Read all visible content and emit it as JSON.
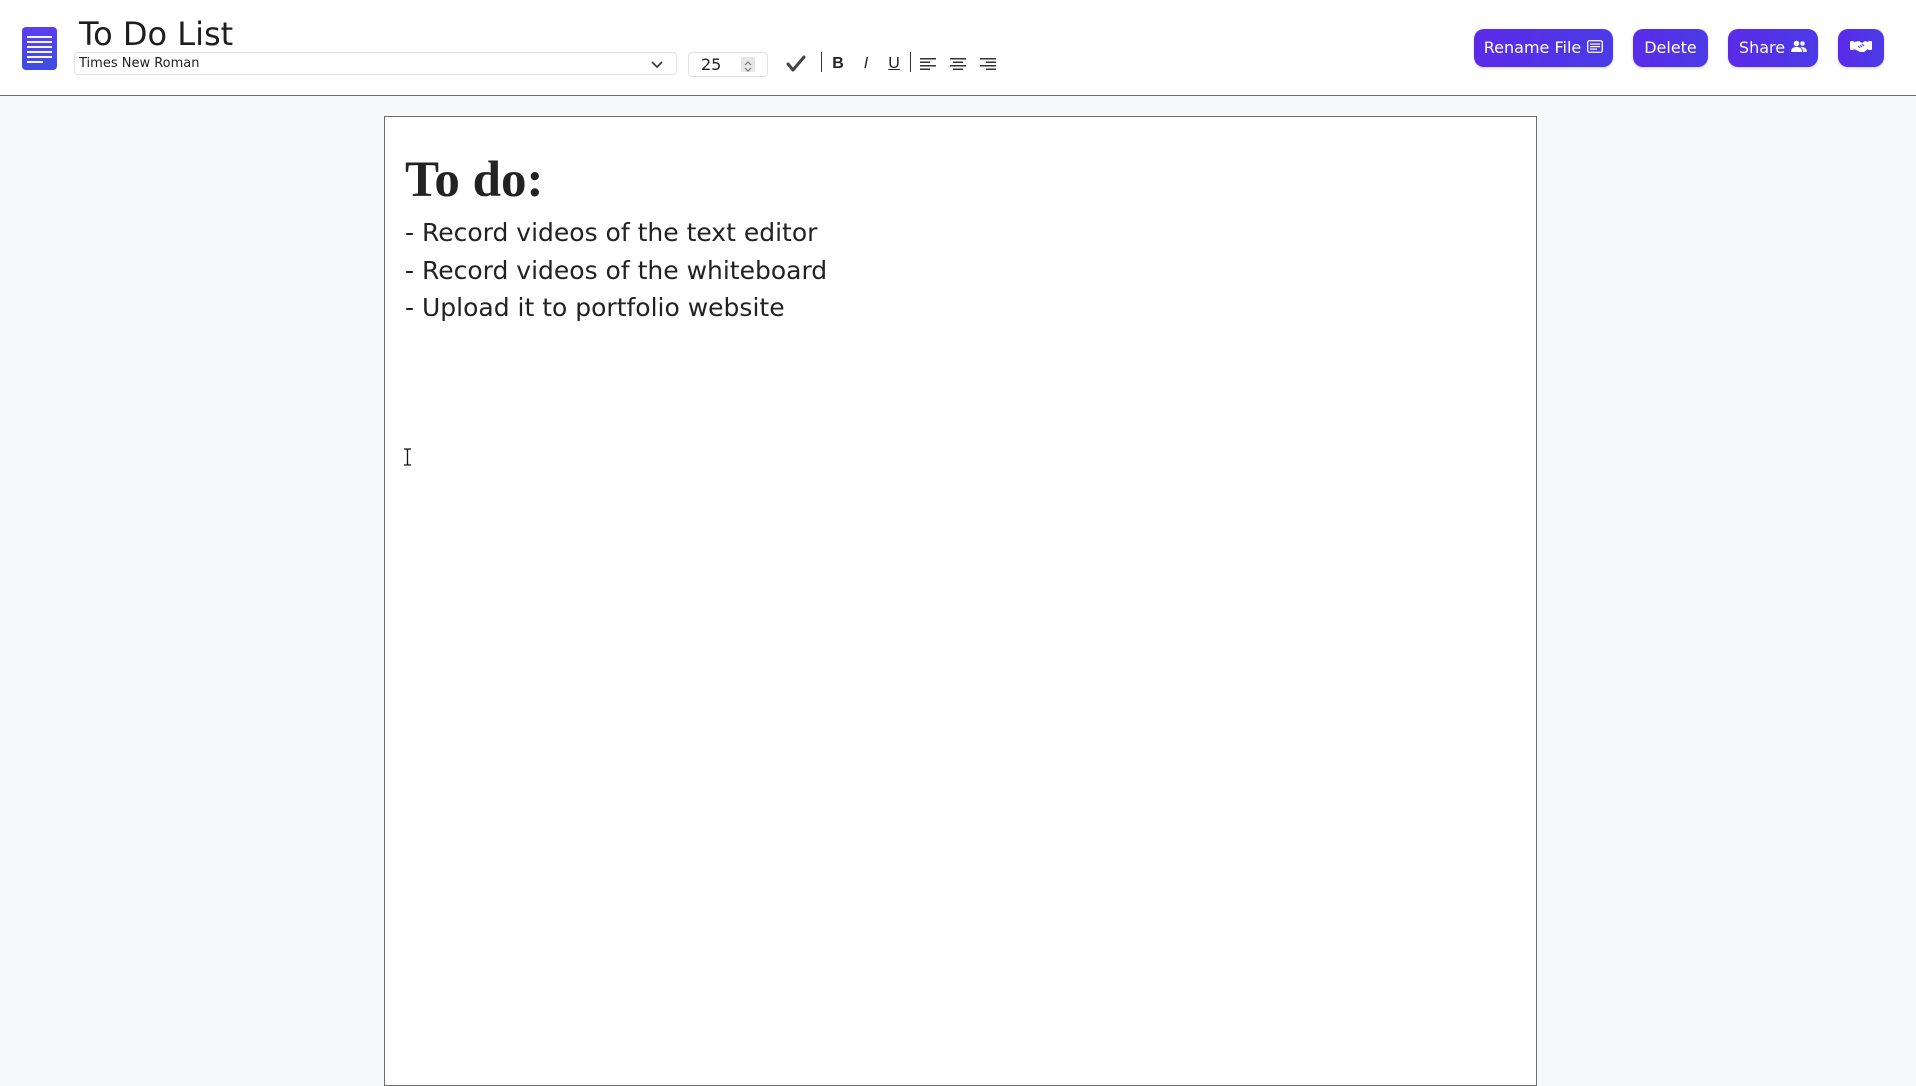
{
  "header": {
    "logo_icon": "document-lines-icon",
    "title": "To Do List"
  },
  "toolbar": {
    "font_family": "Times New Roman",
    "font_size": "25",
    "check_icon": "checkmark-icon",
    "bold_label": "B",
    "italic_label": "I",
    "underline_label": "U",
    "align_left_icon": "align-left-icon",
    "align_center_icon": "align-center-icon",
    "align_right_icon": "align-right-icon"
  },
  "actions": {
    "rename_label": "Rename File",
    "rename_icon": "text-box-icon",
    "delete_label": "Delete",
    "share_label": "Share",
    "share_icon": "users-icon",
    "collab_icon": "handshake-icon"
  },
  "document": {
    "heading": "To do:",
    "lines": [
      "- Record videos of the text editor",
      "- Record videos of the whiteboard",
      "- Upload it to portfolio website"
    ]
  },
  "colors": {
    "accent": "#5531e8",
    "background": "#f7f8fa",
    "page": "#ffffff"
  }
}
